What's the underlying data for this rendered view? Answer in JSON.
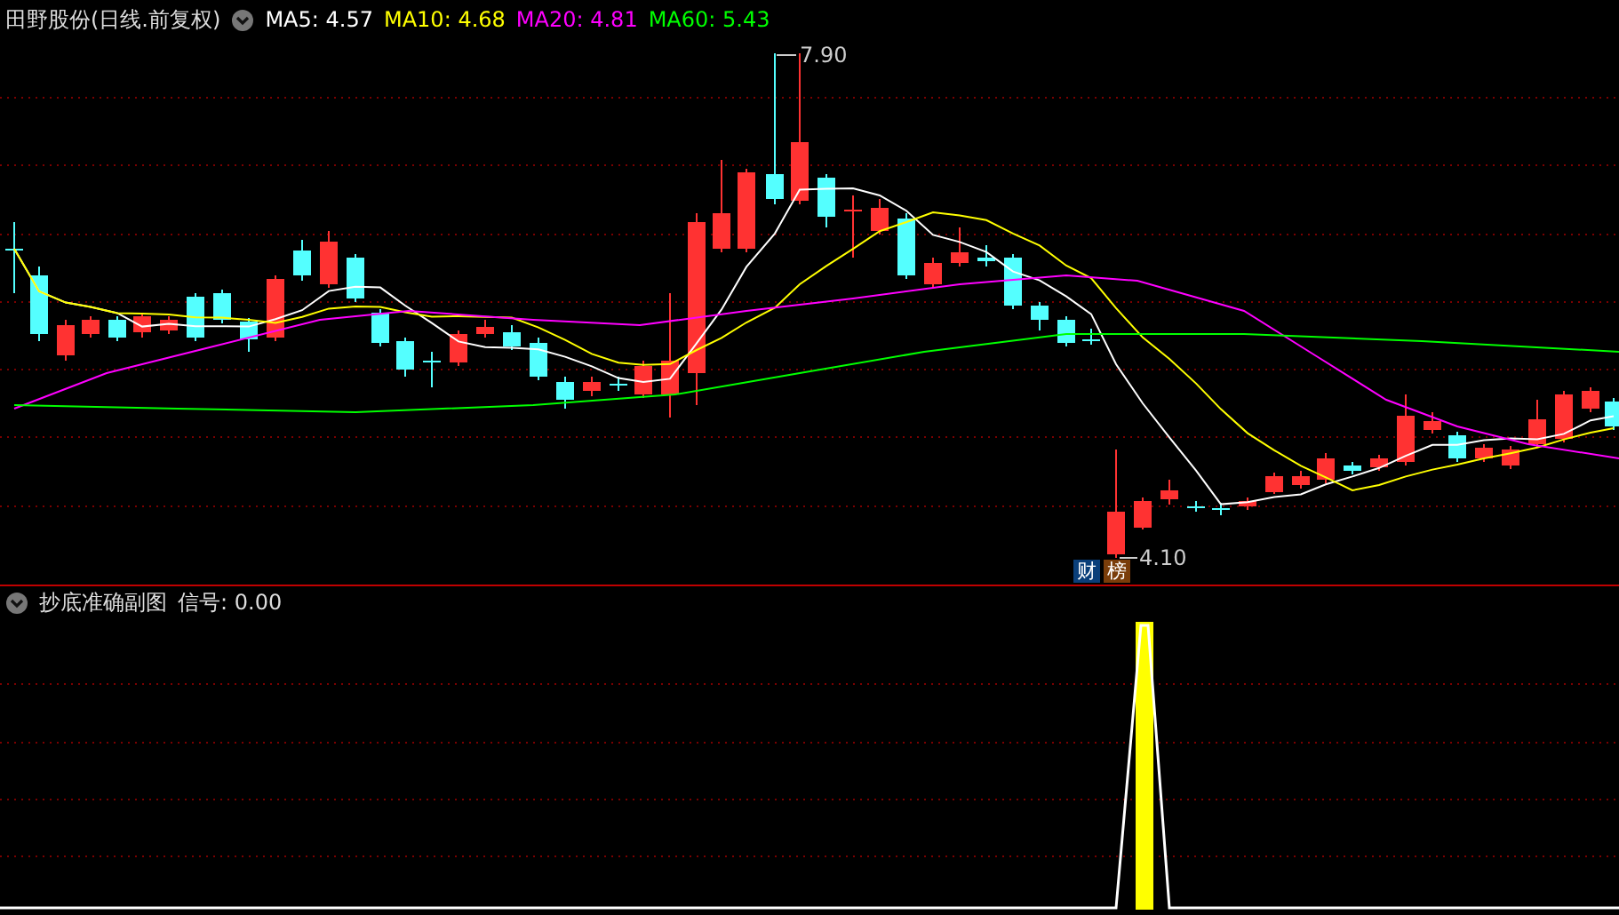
{
  "main_panel": {
    "title": "田野股份(日线.前复权)",
    "indicators": [
      {
        "label": "MA5:",
        "value": "4.57",
        "color": "#ffffff"
      },
      {
        "label": "MA10:",
        "value": "4.68",
        "color": "#ffff00"
      },
      {
        "label": "MA20:",
        "value": "4.81",
        "color": "#ff00ff"
      },
      {
        "label": "MA60:",
        "value": "5.43",
        "color": "#00ff00"
      }
    ],
    "high_label": "7.90",
    "low_label": "4.10",
    "badges": [
      {
        "text": "财",
        "color": "#0a3f7a"
      },
      {
        "text": "榜",
        "color": "#7a3d0a"
      }
    ]
  },
  "sub_panel": {
    "title": "抄底准确副图",
    "signal_label": "信号:",
    "signal_value": "0.00"
  }
}
